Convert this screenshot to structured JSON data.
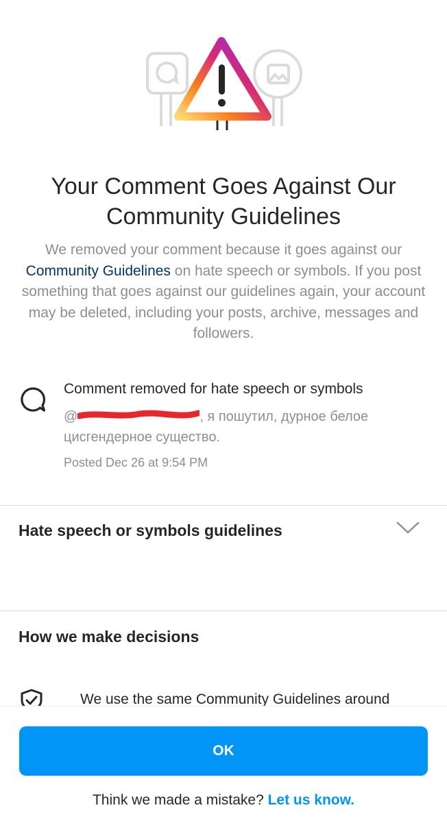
{
  "dialog": {
    "title": "Your Comment Goes Against Our Community Guidelines",
    "description": {
      "before": "We removed your comment because it goes against our ",
      "link": "Community Guidelines",
      "after": " on hate speech or symbols. If you post something that goes against our guidelines again, your account may be deleted, including your posts, archive, messages and followers."
    }
  },
  "comment": {
    "heading": "Comment removed for hate speech or symbols",
    "mention_prefix": "@",
    "text": ", я пошутил, дурное белое цисгендерное существо.",
    "posted": "Posted Dec 26 at 9:54 PM"
  },
  "sections": {
    "hate_speech_title": "Hate speech or symbols guidelines",
    "decisions_title": "How we make decisions",
    "decisions_body": "We use the same Community Guidelines around"
  },
  "footer": {
    "ok_label": "OK",
    "mistake_text": "Think we made a mistake? ",
    "mistake_link": "Let us know."
  },
  "colors": {
    "accent": "#0095f6",
    "link_dark": "#003569",
    "secondary_text": "#8e8e8e",
    "redaction": "#e8262b"
  },
  "icons": [
    "warning-icon",
    "comment-icon",
    "chevron-down-icon",
    "shield-check-icon"
  ]
}
